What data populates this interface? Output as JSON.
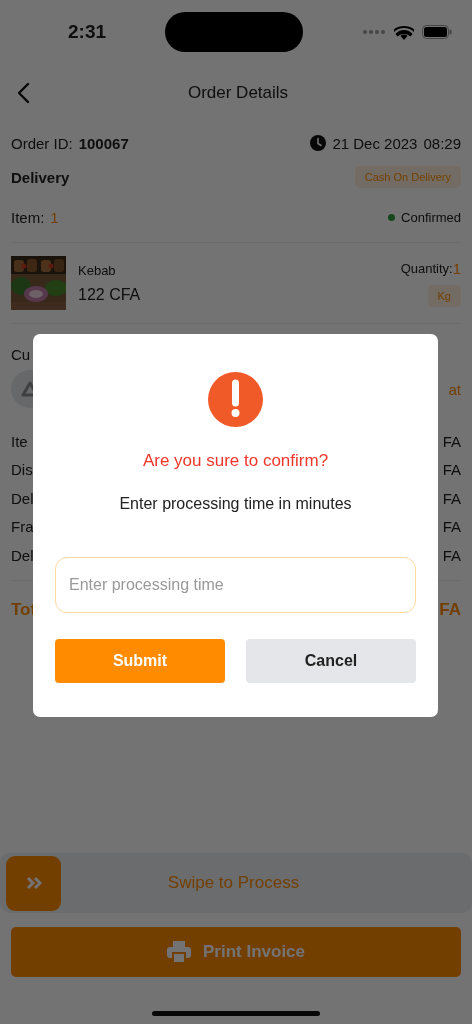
{
  "status_bar": {
    "time": "2:31"
  },
  "header": {
    "title": "Order Details"
  },
  "order": {
    "id_label": "Order ID:",
    "id": "100067",
    "date": "21 Dec 2023",
    "time": "08:29",
    "type": "Delivery",
    "payment": "Cash On Delivery",
    "item_label": "Item:",
    "item_count": "1",
    "status": {
      "label": "Confirmed",
      "color": "#15471c"
    }
  },
  "items": [
    {
      "name": "Kebab",
      "price": "122 CFA",
      "quantity_label": "Quantity:",
      "quantity": "1",
      "unit": "Kg"
    }
  ],
  "customer": {
    "label": "Cu",
    "action": "at"
  },
  "summary": [
    {
      "label": "Ite",
      "value": "FA"
    },
    {
      "label": "Dis",
      "value": "FA"
    },
    {
      "label": "Del",
      "value": "FA"
    },
    {
      "label": "Fra",
      "value": "FA"
    },
    {
      "label": "Del",
      "value": "FA"
    }
  ],
  "total": {
    "label": "Tot",
    "value": "FA"
  },
  "swipe": {
    "label": "Swipe to Process"
  },
  "print_button": {
    "label": "Print Invoice"
  },
  "dialog": {
    "title": "Are you sure to confirm?",
    "message": "Enter processing time in minutes",
    "input": {
      "placeholder": "Enter processing time"
    },
    "buttons": [
      {
        "label": "Submit",
        "kind": "primary"
      },
      {
        "label": "Cancel",
        "kind": "secondary"
      }
    ]
  }
}
